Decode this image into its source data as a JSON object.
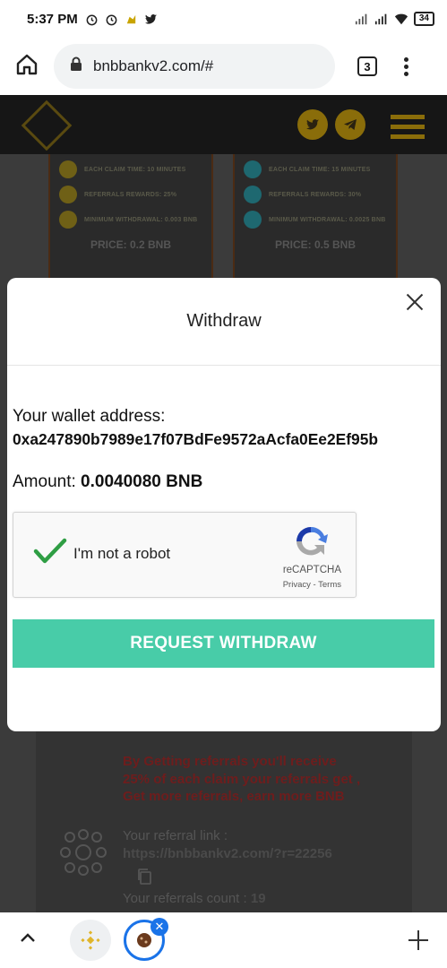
{
  "status_bar": {
    "time": "5:37 PM",
    "battery": "34",
    "icons": [
      "alarm-icon",
      "clock-icon",
      "app-icon",
      "twitter-icon",
      "signal-icon",
      "signal-icon",
      "wifi-icon",
      "battery-icon"
    ]
  },
  "browser": {
    "url": "bnbbankv2.com/#",
    "tab_count": "3"
  },
  "cards": [
    {
      "rows": [
        "EACH CLAIM TIME: 10 MINUTES",
        "REFERRALS REWARDS: 25%",
        "MINIMUM WITHDRAWAL: 0.003 BNB"
      ],
      "price": "PRICE: 0.2 BNB"
    },
    {
      "rows": [
        "EACH CLAIM TIME: 15 MINUTES",
        "REFERRALS REWARDS: 30%",
        "MINIMUM WITHDRAWAL: 0.0025 BNB"
      ],
      "price": "PRICE: 0.5 BNB"
    }
  ],
  "modal": {
    "title": "Withdraw",
    "wallet_label": "Your wallet address:",
    "wallet_address": "0xa247890b7989e17f07BdFe9572aAcfa0Ee2Ef95b",
    "amount_label": "Amount: ",
    "amount_value": "0.0040080 BNB",
    "recaptcha_label": "I'm not a robot",
    "recaptcha_brand": "reCAPTCHA",
    "recaptcha_links": "Privacy - Terms",
    "submit_label": "REQUEST WITHDRAW"
  },
  "referral": {
    "promo": "By Getting referrals you'll receive 25% of each claim your referrals get , Get more referrals, earn more BNB",
    "link_label": "Your referral link :",
    "link": "https://bnbbankv2.com/?r=22256",
    "count_label": "Your referrals count : ",
    "count_value": "19"
  },
  "colors": {
    "accent": "#48cca8",
    "overlay": "#3b3b3b",
    "recaptcha_check": "#2f9e44",
    "chrome_blue": "#1a73e8"
  }
}
